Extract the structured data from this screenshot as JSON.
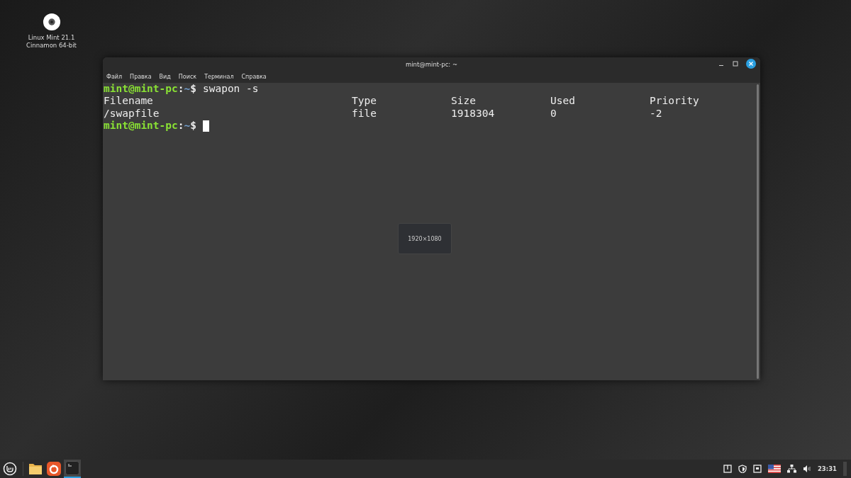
{
  "desktop_icons": [
    {
      "label": "Linux Mint 21.1\nCinnamon 64-bit"
    }
  ],
  "window": {
    "title": "mint@mint-pc: ~",
    "menu": [
      "Файл",
      "Правка",
      "Вид",
      "Поиск",
      "Терминал",
      "Справка"
    ],
    "lines": [
      {
        "kind": "prompt",
        "user": "mint@mint-pc",
        "separator": ":",
        "path": "~",
        "symbol": "$",
        "command": "swapon -s"
      },
      {
        "kind": "output",
        "cells": [
          "Filename",
          "Type",
          "Size",
          "Used",
          "Priority"
        ]
      },
      {
        "kind": "output",
        "cells": [
          "/swapfile",
          "file",
          "1918304",
          "0",
          "-2"
        ]
      },
      {
        "kind": "prompt",
        "user": "mint@mint-pc",
        "separator": ":",
        "path": "~",
        "symbol": "$",
        "cursor": true
      }
    ]
  },
  "resize_tooltip": "1920×1080",
  "taskbar": {
    "apps": [
      {
        "kind": "files",
        "selected": false
      },
      {
        "kind": "browser",
        "selected": false
      },
      {
        "kind": "terminal",
        "selected": true
      }
    ],
    "clock": "23:31"
  }
}
